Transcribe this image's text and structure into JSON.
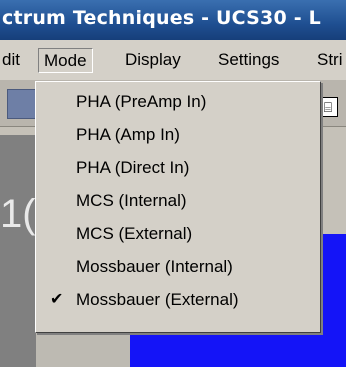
{
  "window": {
    "title": "ctrum Techniques - UCS30 - L"
  },
  "menu": {
    "items": [
      "dit",
      "Mode",
      "Display",
      "Settings",
      "Stri"
    ]
  },
  "toolbar": {
    "icon_glyph": "⌸"
  },
  "workspace": {
    "left_digits": "1("
  },
  "dropdown": {
    "items": [
      {
        "label": "PHA (PreAmp In)",
        "checked": false
      },
      {
        "label": "PHA (Amp In)",
        "checked": false
      },
      {
        "label": "PHA (Direct In)",
        "checked": false
      },
      {
        "label": "MCS (Internal)",
        "checked": false
      },
      {
        "label": "MCS (External)",
        "checked": false
      },
      {
        "label": "Mossbauer (Internal)",
        "checked": false
      },
      {
        "label": "Mossbauer (External)",
        "checked": true
      }
    ],
    "check_glyph": "✔"
  },
  "colors": {
    "title_bar": "#1f4f91",
    "menu_bg": "#d4d0c8",
    "blue_area": "#1414f7"
  }
}
